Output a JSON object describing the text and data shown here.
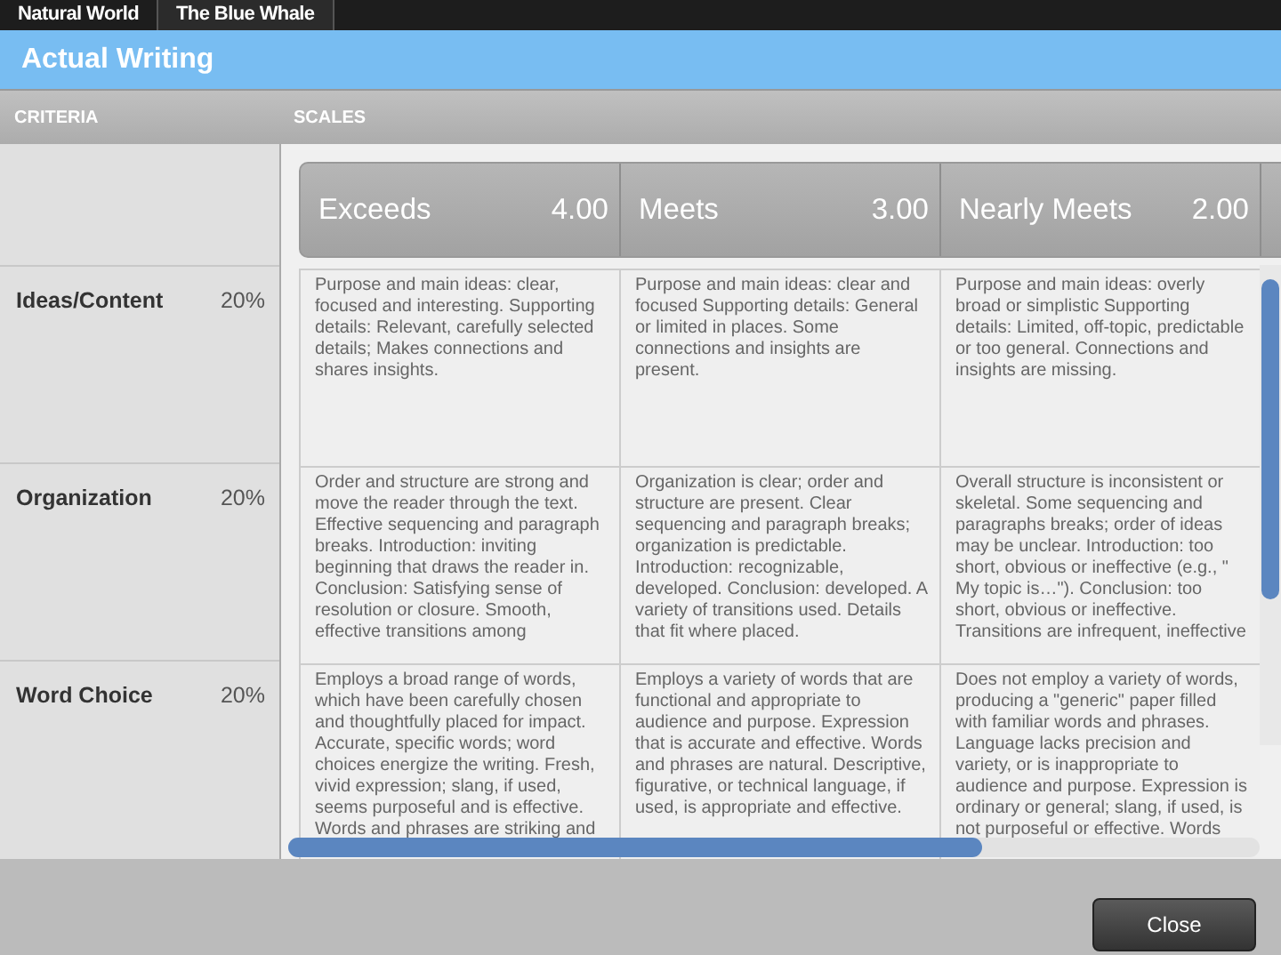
{
  "tabs": [
    {
      "label": "Natural World",
      "selected": false
    },
    {
      "label": "The Blue Whale",
      "selected": true
    }
  ],
  "title": "Actual Writing",
  "headers": {
    "criteria": "CRITERIA",
    "scales": "SCALES"
  },
  "scales": [
    {
      "name": "Exceeds",
      "points": "4.00"
    },
    {
      "name": "Meets",
      "points": "3.00"
    },
    {
      "name": "Nearly Meets",
      "points": "2.00"
    }
  ],
  "criteria": [
    {
      "name": "Ideas/Content",
      "weight": "20%",
      "cells": [
        "Purpose and main ideas: clear, focused and interesting. Supporting details: Relevant, carefully selected details; Makes connections and shares insights.",
        "Purpose and main ideas: clear and focused Supporting details: General or limited in places. Some connections and insights are present.",
        "Purpose and main ideas: overly broad or simplistic Supporting details: Limited, off-topic, predictable or too general. Connections and insights are missing."
      ]
    },
    {
      "name": "Organization",
      "weight": "20%",
      "cells": [
        "Order and structure are strong and move the reader through the text. Effective sequencing and paragraph breaks. Introduction: inviting beginning that draws the reader in. Conclusion: Satisfying sense of resolution or closure. Smooth, effective transitions among",
        "Organization is clear; order and structure are present. Clear sequencing and paragraph breaks; organization is predictable. Introduction: recognizable, developed. Conclusion: developed. A variety of transitions used. Details that fit where placed.",
        "Overall structure is inconsistent or skeletal. Some sequencing and paragraphs breaks; order of ideas may be unclear. Introduction: too short, obvious or ineffective (e.g., \" My topic is…\"). Conclusion: too short, obvious or ineffective. Transitions are infrequent, ineffective"
      ]
    },
    {
      "name": "Word Choice",
      "weight": "20%",
      "cells": [
        "Employs a broad range of words, which have been carefully chosen and thoughtfully placed for impact. Accurate, specific words; word choices energize the writing. Fresh, vivid expression; slang, if used, seems purposeful and is effective. Words and phrases are striking and",
        "Employs a variety of words that are functional and appropriate to audience and purpose. Expression that is accurate and effective. Words and phrases are natural. Descriptive, figurative, or technical language, if used, is appropriate and effective.",
        "Does not employ a variety of words, producing a \"generic\" paper filled with familiar words and phrases. Language lacks precision and variety, or is inappropriate to audience and purpose. Expression is ordinary or general; slang, if used, is not purposeful or effective. Words"
      ]
    }
  ],
  "close_button": "Close"
}
